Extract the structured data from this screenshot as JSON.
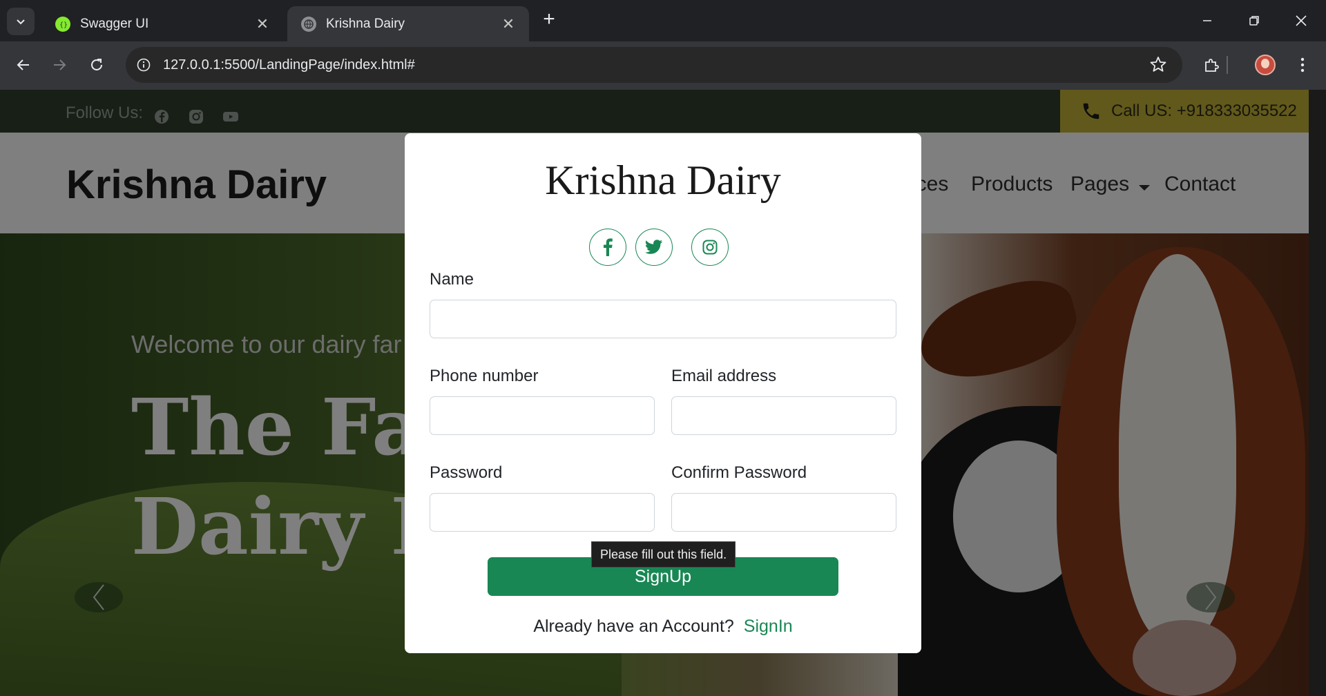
{
  "browser": {
    "tabs": [
      {
        "title": "Swagger UI",
        "active": false
      },
      {
        "title": "Krishna Dairy",
        "active": true
      }
    ],
    "url": "127.0.0.1:5500/LandingPage/index.html#"
  },
  "site": {
    "topbar": {
      "follow_label": "Follow Us:",
      "call_text": "Call US: +918333035522"
    },
    "brand": "Krishna Dairy",
    "nav": [
      "ices",
      "Products",
      "Pages",
      "Contact"
    ],
    "hero": {
      "welcome": "Welcome to our dairy far",
      "title_line1": "The Far",
      "title_line2": "Dairy P"
    }
  },
  "modal": {
    "title": "Krishna Dairy",
    "social_icons": [
      "facebook-icon",
      "twitter-icon",
      "instagram-icon"
    ],
    "fields": {
      "name_label": "Name",
      "phone_label": "Phone number",
      "email_label": "Email address",
      "password_label": "Password",
      "confirm_label": "Confirm Password"
    },
    "tooltip": "Please fill out this field.",
    "submit_label": "SignUp",
    "footer_text": "Already have an Account?",
    "signin_label": "SignIn"
  },
  "colors": {
    "accent": "#198754",
    "topbar": "#2e3f2e",
    "callbox": "#c3b036"
  }
}
